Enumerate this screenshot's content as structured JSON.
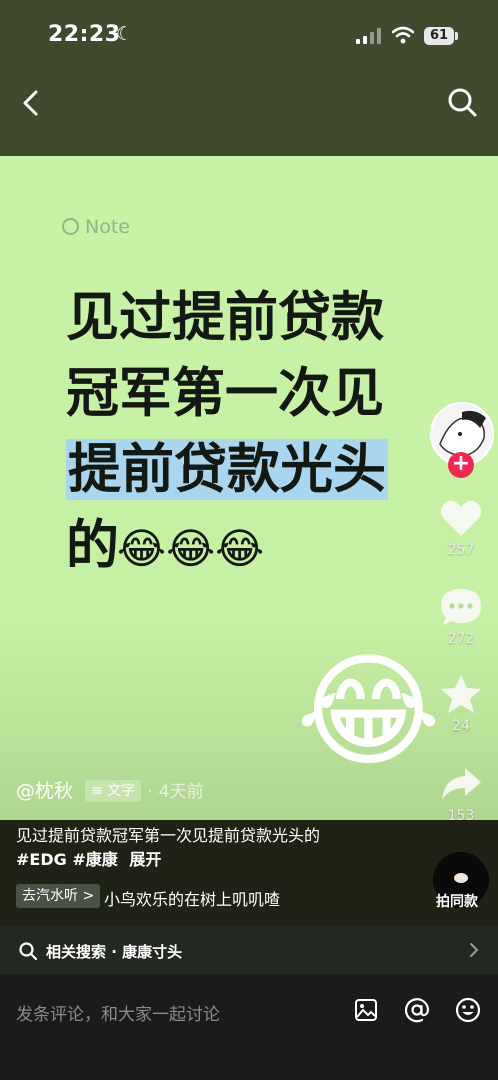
{
  "status_bar": {
    "time": "22:23",
    "battery": "61"
  },
  "nav": {
    "back_icon": "chevron-left-icon",
    "search_icon": "search-icon"
  },
  "post": {
    "note_label": "Note",
    "headline_line1": "见过提前贷款",
    "headline_line2": "冠军第一次见",
    "headline_line3": "提前贷款光头",
    "headline_line4": "的",
    "headline_emojis": "😂😂😂",
    "big_emoji": "😂"
  },
  "rail": {
    "likes": "257",
    "comments": "272",
    "favorites": "24",
    "shares": "153",
    "follow_label": "+"
  },
  "meta": {
    "author": "@枕秋",
    "type_tag": "文字",
    "time_ago": "4天前",
    "separator": "·"
  },
  "caption": {
    "text": "见过提前贷款冠军第一次见提前贷款光头的",
    "tags": "#EDG #康康",
    "expand": "展开"
  },
  "music": {
    "chip": "去汽水听 >",
    "title": "小鸟欢乐的在树上叽叽喳"
  },
  "remix": {
    "label": "拍同款"
  },
  "related": {
    "text": "相关搜索 · 康康寸头"
  },
  "comment": {
    "placeholder": "发条评论，和大家一起讨论"
  },
  "colors": {
    "card_bg": "#c8f2a6",
    "highlight": "#a9d6ee",
    "follow": "#ef2a52"
  }
}
